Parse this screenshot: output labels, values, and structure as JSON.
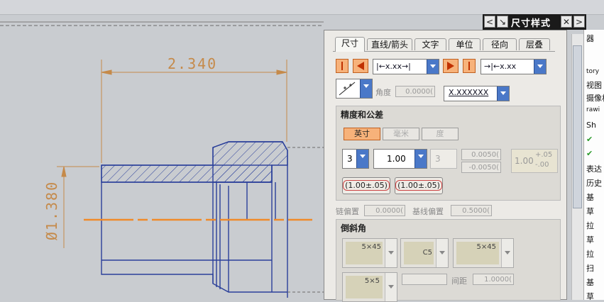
{
  "titlebar": {
    "title": "尺寸样式",
    "left_arrow": "<",
    "pin": "↘",
    "close": "✕",
    "right_arrow": ">"
  },
  "drawing": {
    "dim_horizontal": "2.340",
    "dim_vertical": "Ø1.380"
  },
  "tabs": [
    "尺寸",
    "直线/箭头",
    "文字",
    "单位",
    "径向",
    "层叠"
  ],
  "active_tab": "尺寸",
  "row1": {
    "dropdown1_sample": "|←x.xx→|",
    "dropdown2_sample": "→|←x.xx"
  },
  "row2": {
    "angle_label": "角度",
    "angle_value": "0.0000(",
    "dropdown_sample": "X.XXXXXX"
  },
  "precision": {
    "title": "精度和公差",
    "units": [
      "英寸",
      "毫米",
      "度"
    ],
    "active_unit": "英寸",
    "precision_value": "3",
    "tolerance_value": "1.00",
    "tolerance_precision": "3",
    "upper_tol": "0.0050(",
    "lower_tol": "-0.0050(",
    "tol_preview_main": "1.00",
    "tol_preview_upper": "+.05",
    "tol_preview_lower": "-.00",
    "tol_btn1": "(1.00±.05)",
    "tol_btn2": "(1.00±.05)"
  },
  "offsets": {
    "chain_label": "链偏置",
    "chain_value": "0.0000(",
    "baseline_label": "基线偏置",
    "baseline_value": "0.5000("
  },
  "chamfer": {
    "title": "倒斜角",
    "opt1": "5×45",
    "opt2": "C5",
    "opt3": "5×45",
    "opt4": "5×5",
    "spacing_label": "间距",
    "spacing_value": "1.0000("
  },
  "tree": {
    "header": "器",
    "items": [
      "tory",
      "视图",
      "摄像机",
      "rawi",
      "Sh",
      "",
      "",
      "表达",
      "历史",
      "基",
      "草",
      "拉",
      "草",
      "拉",
      "扫",
      "基",
      "草"
    ]
  },
  "colors": {
    "dim": "#c58a4a",
    "part": "#2a3f9a",
    "center": "#f08a2a",
    "accent": "#f7b27a",
    "dropdown": "#4a78c8"
  }
}
